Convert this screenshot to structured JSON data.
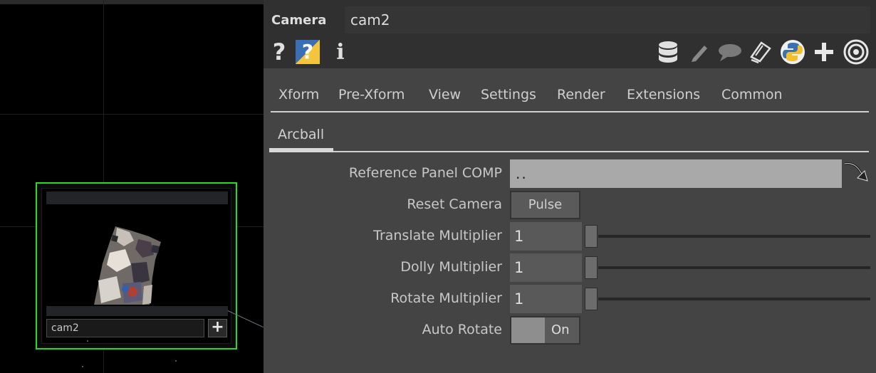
{
  "network": {
    "node": {
      "name": "cam2",
      "plus_glyph": "+"
    }
  },
  "header": {
    "op_type": "Camera",
    "op_name": "cam2",
    "left_icons": [
      {
        "name": "help-icon",
        "glyph": "?"
      },
      {
        "name": "python-help-icon",
        "glyph": "?"
      },
      {
        "name": "info-icon",
        "glyph": "i"
      }
    ],
    "right_icons": [
      "database-icon",
      "edit-icon",
      "comment-icon",
      "clone-icon",
      "python-icon",
      "add-icon",
      "target-icon"
    ]
  },
  "tabs": [
    "Xform",
    "Pre-Xform",
    "View",
    "Settings",
    "Render",
    "Extensions",
    "Common"
  ],
  "subtab": "Arcball",
  "params": {
    "reference_panel": {
      "label": "Reference Panel COMP",
      "value": ".."
    },
    "reset_camera": {
      "label": "Reset Camera",
      "button": "Pulse"
    },
    "translate_multiplier": {
      "label": "Translate Multiplier",
      "value": "1"
    },
    "dolly_multiplier": {
      "label": "Dolly Multiplier",
      "value": "1"
    },
    "rotate_multiplier": {
      "label": "Rotate Multiplier",
      "value": "1"
    },
    "auto_rotate": {
      "label": "Auto Rotate",
      "value": "On"
    }
  },
  "colors": {
    "node_selected": "#22dd22",
    "panel_bg": "#444444",
    "header_bg": "#303030"
  }
}
